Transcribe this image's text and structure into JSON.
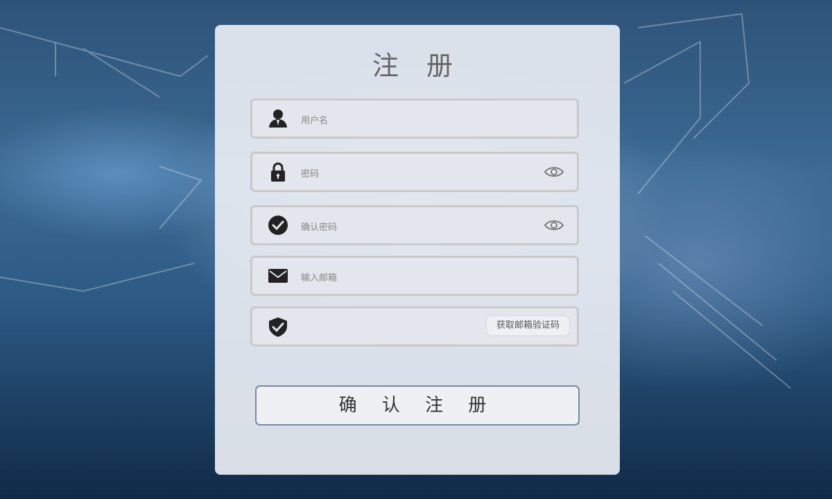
{
  "form": {
    "title": "注 册",
    "fields": {
      "username": {
        "placeholder": "用户名",
        "icon": "user-icon"
      },
      "password": {
        "placeholder": "密码",
        "icon": "lock-icon",
        "toggle_icon": "eye-icon"
      },
      "confirm_password": {
        "placeholder": "确认密码",
        "icon": "check-circle-icon",
        "toggle_icon": "eye-icon"
      },
      "email": {
        "placeholder": "输入邮箱",
        "icon": "envelope-icon"
      },
      "verification_code": {
        "placeholder": "",
        "icon": "shield-check-icon",
        "button_label": "获取邮箱验证码"
      }
    },
    "submit_label": "确 认 注 册"
  },
  "colors": {
    "card_bg": "#e8ecf2",
    "field_border": "#c9c9c9",
    "submit_border": "#7a8aa6",
    "icon_color": "#222222"
  }
}
